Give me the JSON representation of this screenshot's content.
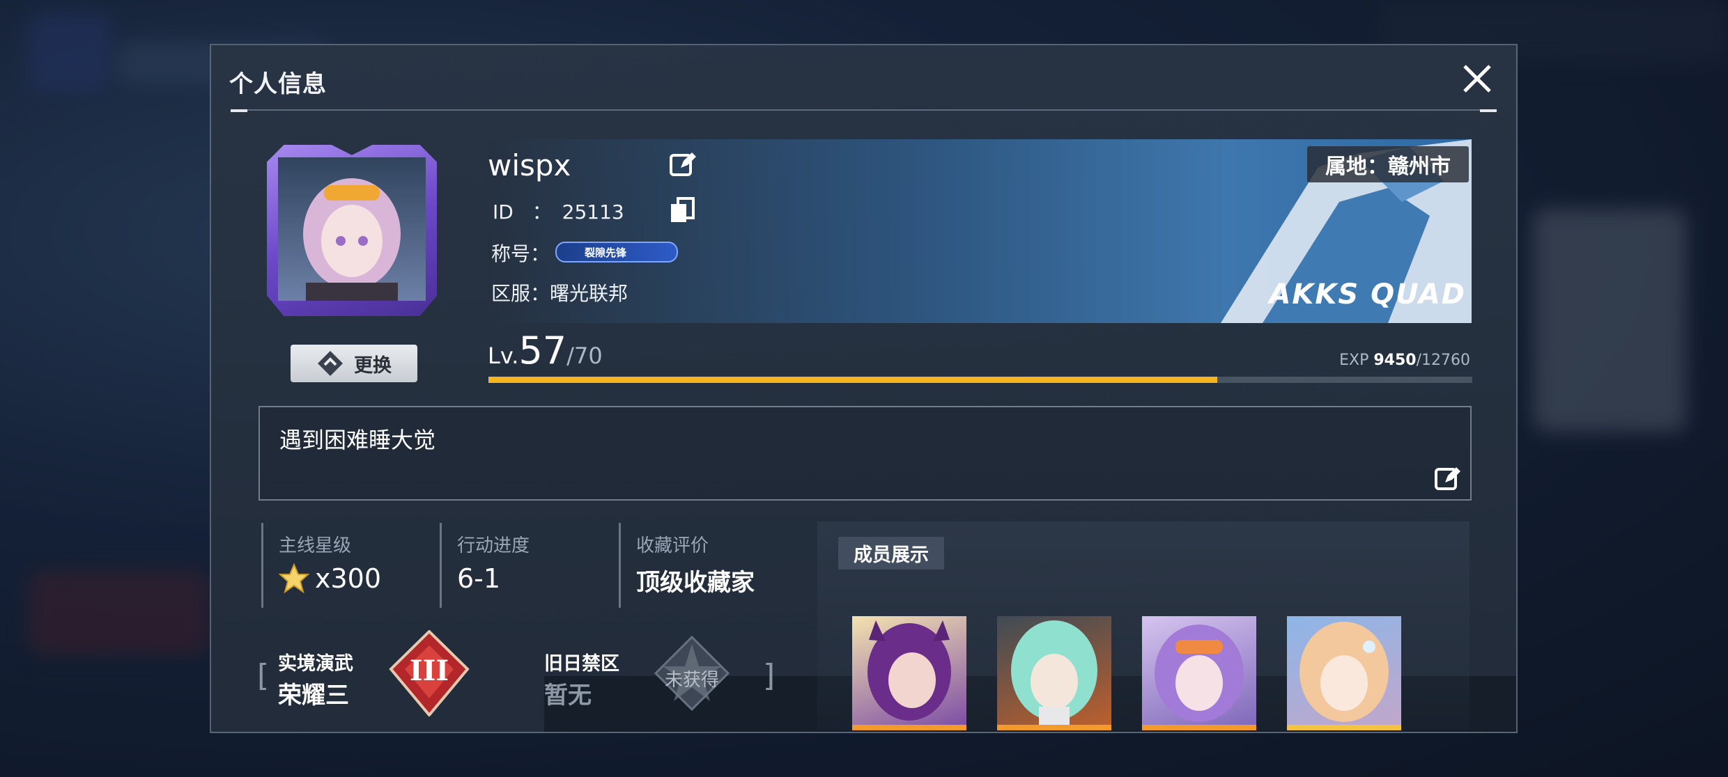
{
  "dialog": {
    "title": "个人信息"
  },
  "profile": {
    "username": "wispx",
    "id_label": "ID",
    "id_sep": "：",
    "id_value": "25113",
    "title_label": "称号：",
    "title_badge": "裂隙先锋",
    "server_label": "区服：",
    "server_value": "曙光联邦",
    "location": "属地：赣州市",
    "banner_text": "AKKS QUAD",
    "change_button": "更换"
  },
  "level": {
    "prefix": "Lv.",
    "current": "57",
    "max": "/70",
    "exp_label": "EXP",
    "exp_current": "9450",
    "exp_max": "/12760",
    "exp_fraction": 0.7406,
    "bar_color": "#f6b51f"
  },
  "signature": {
    "text": "遇到困难睡大觉"
  },
  "stats": [
    {
      "label": "主线星级",
      "value": "x300",
      "icon": "star-icon"
    },
    {
      "label": "行动进度",
      "value": "6-1"
    },
    {
      "label": "收藏评价",
      "value": "顶级收藏家"
    }
  ],
  "arena": {
    "real": {
      "label": "实境演武",
      "value": "荣耀三",
      "badge_text": "III"
    },
    "old": {
      "label": "旧日禁区",
      "value": "暂无",
      "badge_text": "未获得"
    }
  },
  "members": {
    "title": "成员展示",
    "items": [
      {
        "name": "member-1",
        "color": "#f39a2c"
      },
      {
        "name": "member-2",
        "color": "#f39a2c"
      },
      {
        "name": "member-3",
        "color": "#f39a2c"
      },
      {
        "name": "member-4",
        "color": "#f5c342"
      }
    ]
  }
}
